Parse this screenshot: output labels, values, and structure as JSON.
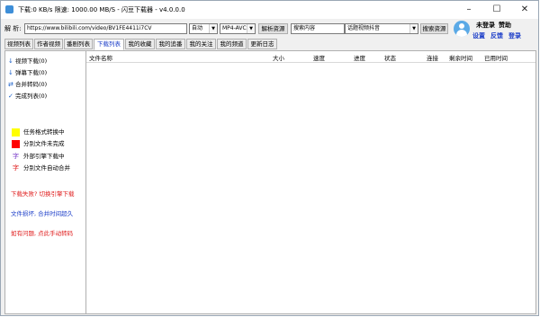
{
  "titlebar": {
    "title": "下载:0 KB/s  限速: 1000.00 MB/S - 闪豆下载器 - v4.0.0.0",
    "min": "–",
    "max": "☐",
    "close": "✕"
  },
  "toolbar": {
    "parse_label": "解 析:",
    "url_value": "https://www.bilibili.com/video/BV1FE4411i7CV",
    "quality_value": "自动",
    "codec_value": "MP4-AVC",
    "parse_button": "解析资源",
    "search_placeholder": "搜索内容",
    "search_type_value": "话题视频抖音",
    "search_button": "搜索资源"
  },
  "user": {
    "status": "未登录",
    "sponsor": "赞助",
    "settings": "设置",
    "feedback": "反馈",
    "login": "登录"
  },
  "tabs": [
    "视频列表",
    "作者视频",
    "番剧列表",
    "下载列表",
    "我的收藏",
    "我的追番",
    "我的关注",
    "我的频道",
    "更新日志"
  ],
  "active_tab": "下载列表",
  "sidebar": {
    "nav": [
      {
        "icon": "↓",
        "label": "视频下载(0)"
      },
      {
        "icon": "↓",
        "label": "弹幕下载(0)"
      },
      {
        "icon": "⇄",
        "label": "合并转码(0)"
      },
      {
        "icon": "✓",
        "label": "完成列表(0)"
      }
    ],
    "legend": [
      {
        "color": "#ffff00",
        "label": "任务格式转换中"
      },
      {
        "color": "#ff0000",
        "label": "分别文件未完成"
      },
      {
        "glyph": "字",
        "glyph_color": "#7a3cc8",
        "label": "外部引擎下载中"
      },
      {
        "glyph": "字",
        "glyph_color": "#e02020",
        "label": "分别文件自动合并"
      }
    ],
    "notes": [
      {
        "text": "下载失败? 切换引擎下载",
        "color": "#e02020"
      },
      {
        "text": "文件损坏, 合并时间超久",
        "color": "#1a3cc8"
      },
      {
        "text": "如有问题, 点此手动转码",
        "color": "#e02020"
      }
    ]
  },
  "table": {
    "columns": [
      "文件名称",
      "大小",
      "速度",
      "进度",
      "状态",
      "连接",
      "剩余时间",
      "已用时间"
    ]
  }
}
